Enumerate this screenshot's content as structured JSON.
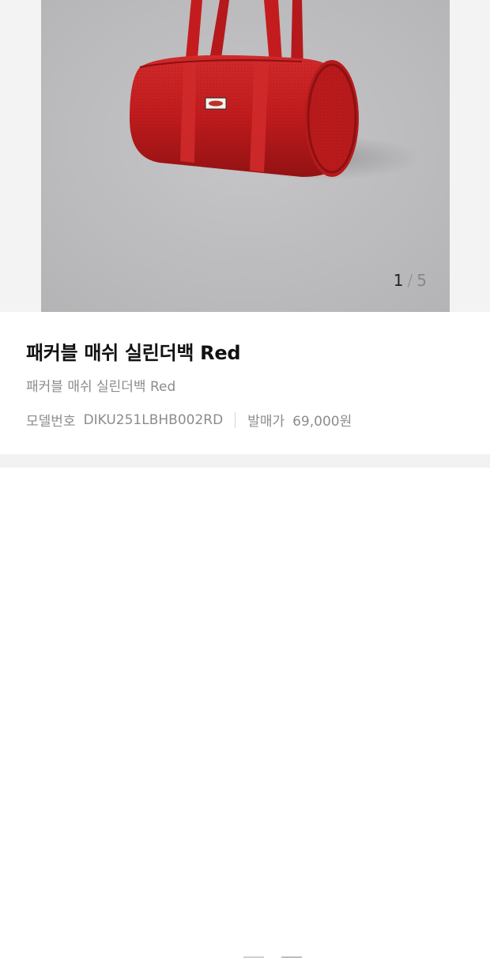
{
  "gallery": {
    "current_index": "1",
    "separator": "/",
    "total": "5"
  },
  "product": {
    "title": "패커블 매쉬 실린더백 Red",
    "subtitle": "패커블 매쉬 실린더백 Red",
    "model_label": "모델번호",
    "model_value": "DIKU251LBHB002RD",
    "price_label": "발매가",
    "price_value": "69,000원"
  },
  "colors": {
    "photo_bg": "#bdbcbe",
    "bag_red": "#c81d1f",
    "text_primary": "#111111",
    "text_secondary": "#8c8c8c"
  }
}
